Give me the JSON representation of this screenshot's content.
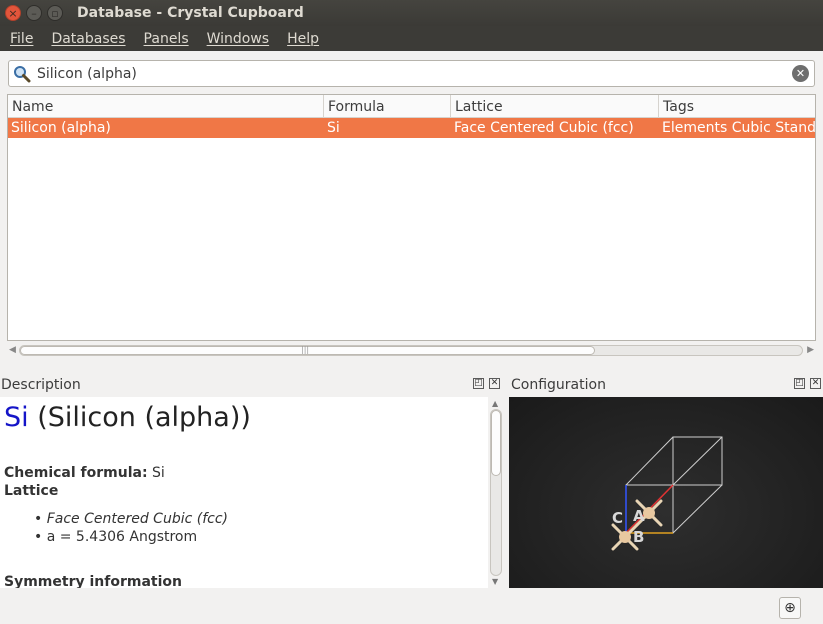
{
  "window": {
    "title": "Database - Crystal Cupboard",
    "close_glyph": "×",
    "minimize_glyph": "–",
    "maximize_glyph": "▫"
  },
  "menu": [
    "File",
    "Databases",
    "Panels",
    "Windows",
    "Help"
  ],
  "search": {
    "value": "Silicon (alpha)",
    "icon": "search-icon",
    "clear_icon": "clear-icon"
  },
  "table": {
    "columns": [
      "Name",
      "Formula",
      "Lattice",
      "Tags"
    ],
    "rows": [
      {
        "name": "Silicon (alpha)",
        "formula": "Si",
        "lattice": "Face Centered Cubic (fcc)",
        "tags": "Elements Cubic Standa"
      }
    ],
    "selected_row_color": "#f07746"
  },
  "description": {
    "header": "Description",
    "symbol": "Si",
    "title_rest": " (Silicon (alpha))",
    "chemical_formula_label": "Chemical formula:",
    "chemical_formula_value": " Si",
    "lattice_label": "Lattice",
    "lattice_items": [
      "Face Centered Cubic (fcc)",
      "a = 5.4306 Angstrom"
    ],
    "symmetry_label": "Symmetry information"
  },
  "configuration": {
    "header": "Configuration",
    "axis_labels": [
      "C",
      "A",
      "B"
    ]
  },
  "colors": {
    "titlebar": "#3c3b37",
    "accent": "#f07746",
    "symbol_blue": "#1515c8"
  }
}
